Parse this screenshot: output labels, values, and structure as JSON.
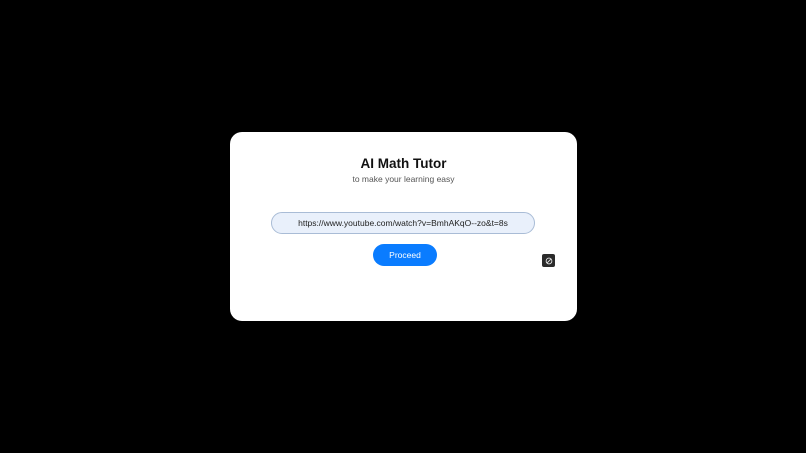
{
  "app": {
    "title": "AI Math Tutor",
    "subtitle": "to make your learning easy"
  },
  "form": {
    "url_value": "https://www.youtube.com/watch?v=BmhAKqO--zo&t=8s",
    "proceed_label": "Proceed"
  },
  "icons": {
    "corner": "slash-circle-icon"
  },
  "colors": {
    "background": "#000000",
    "card": "#ffffff",
    "accent": "#0a7cff",
    "input_bg": "#e9f0fb"
  }
}
